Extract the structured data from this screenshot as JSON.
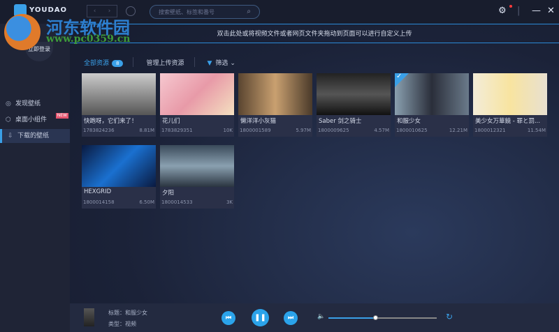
{
  "app": {
    "brand": "YOUDAO",
    "search_placeholder": "搜索壁纸、标签和番号",
    "banner": "双击此处或将视频文件或者网页文件夹拖动到页面可以进行自定义上传",
    "login": "立即登录"
  },
  "window": {
    "settings": "⚙",
    "minimize": "—",
    "close": "✕"
  },
  "sidebar": {
    "items": [
      {
        "label": "发现壁纸",
        "icon": "◎"
      },
      {
        "label": "桌面小组件",
        "icon": "⬡",
        "badge": "NEW"
      },
      {
        "label": "下载的壁纸",
        "icon": "⇩"
      }
    ]
  },
  "tabs": {
    "all": "全部资源",
    "count": "8",
    "manage": "管理上传资源",
    "filter": "筛选"
  },
  "cards": [
    {
      "title": "快跑呀，它们来了！",
      "id": "1783824236",
      "size": "8.81M",
      "color": "linear-gradient(#ccc,#555)"
    },
    {
      "title": "花儿们",
      "id": "1783829351",
      "size": "10K",
      "color": "linear-gradient(135deg,#f6c8d0,#e89aa8,#f4e0c0)"
    },
    {
      "title": "懒洋洋小灰猫",
      "id": "1800001589",
      "size": "5.97M",
      "color": "linear-gradient(90deg,#5a4530,#c9a070,#4a3a2a)"
    },
    {
      "title": "Saber 剑之骑士",
      "id": "1800009625",
      "size": "4.57M",
      "color": "linear-gradient(#222,#555,#111)"
    },
    {
      "title": "和服少女",
      "id": "1800010625",
      "size": "12.21M",
      "color": "linear-gradient(90deg,#8aa0b0,#2a2e3a,#6a7a8a)",
      "checked": true
    },
    {
      "title": "美少女万華鏡 - 罪と罰...",
      "id": "1800012321",
      "size": "11.54M",
      "color": "linear-gradient(90deg,#f3ecd8,#f8e4a0,#e8e0d0)"
    },
    {
      "title": "HEXGRID",
      "id": "1800014158",
      "size": "6.50M",
      "color": "linear-gradient(135deg,#0a1a40,#1a70d0,#0a1a40)"
    },
    {
      "title": "夕阳",
      "id": "1800014533",
      "size": "3K",
      "color": "linear-gradient(#3a4a5a,#8aa0b0 50%,#2a3440)"
    }
  ],
  "player": {
    "title": "标题：和服少女",
    "type": "类型：视频",
    "volume": 0.43,
    "prev": "⏮",
    "pause": "❚❚",
    "next": "⏭",
    "volume_icon": "🔈",
    "loop_icon": "↻"
  },
  "watermark": {
    "name": "河东软件园",
    "url": "www.pc0359.cn"
  }
}
